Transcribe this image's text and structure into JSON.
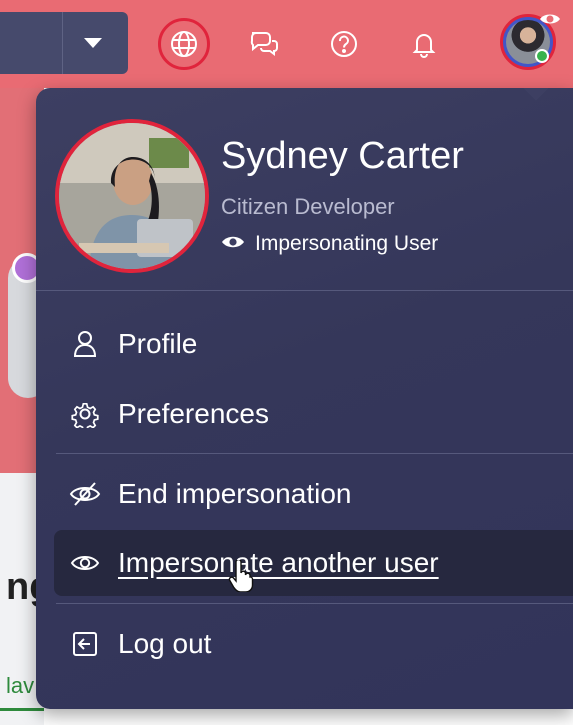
{
  "header": {
    "icons": [
      "chevron-down-icon",
      "globe-icon",
      "chat-icon",
      "help-icon",
      "bell-icon",
      "eye-icon"
    ],
    "colors": {
      "bar": "#e96b73",
      "focus_ring": "#e0243c",
      "presence": "#37b24d"
    }
  },
  "background_page": {
    "heading_fragment": "ng",
    "link_fragment": "lav"
  },
  "user": {
    "name": "Sydney Carter",
    "role": "Citizen Developer",
    "status": "Impersonating User"
  },
  "menu": {
    "background": "#3a3c60",
    "items": [
      {
        "label": "Profile",
        "icon": "person-icon"
      },
      {
        "label": "Preferences",
        "icon": "gear-icon"
      },
      {
        "label": "End impersonation",
        "icon": "eye-off-icon"
      },
      {
        "label": "Impersonate another user",
        "icon": "eye-icon",
        "state": "hover"
      },
      {
        "label": "Log out",
        "icon": "logout-icon"
      }
    ]
  }
}
